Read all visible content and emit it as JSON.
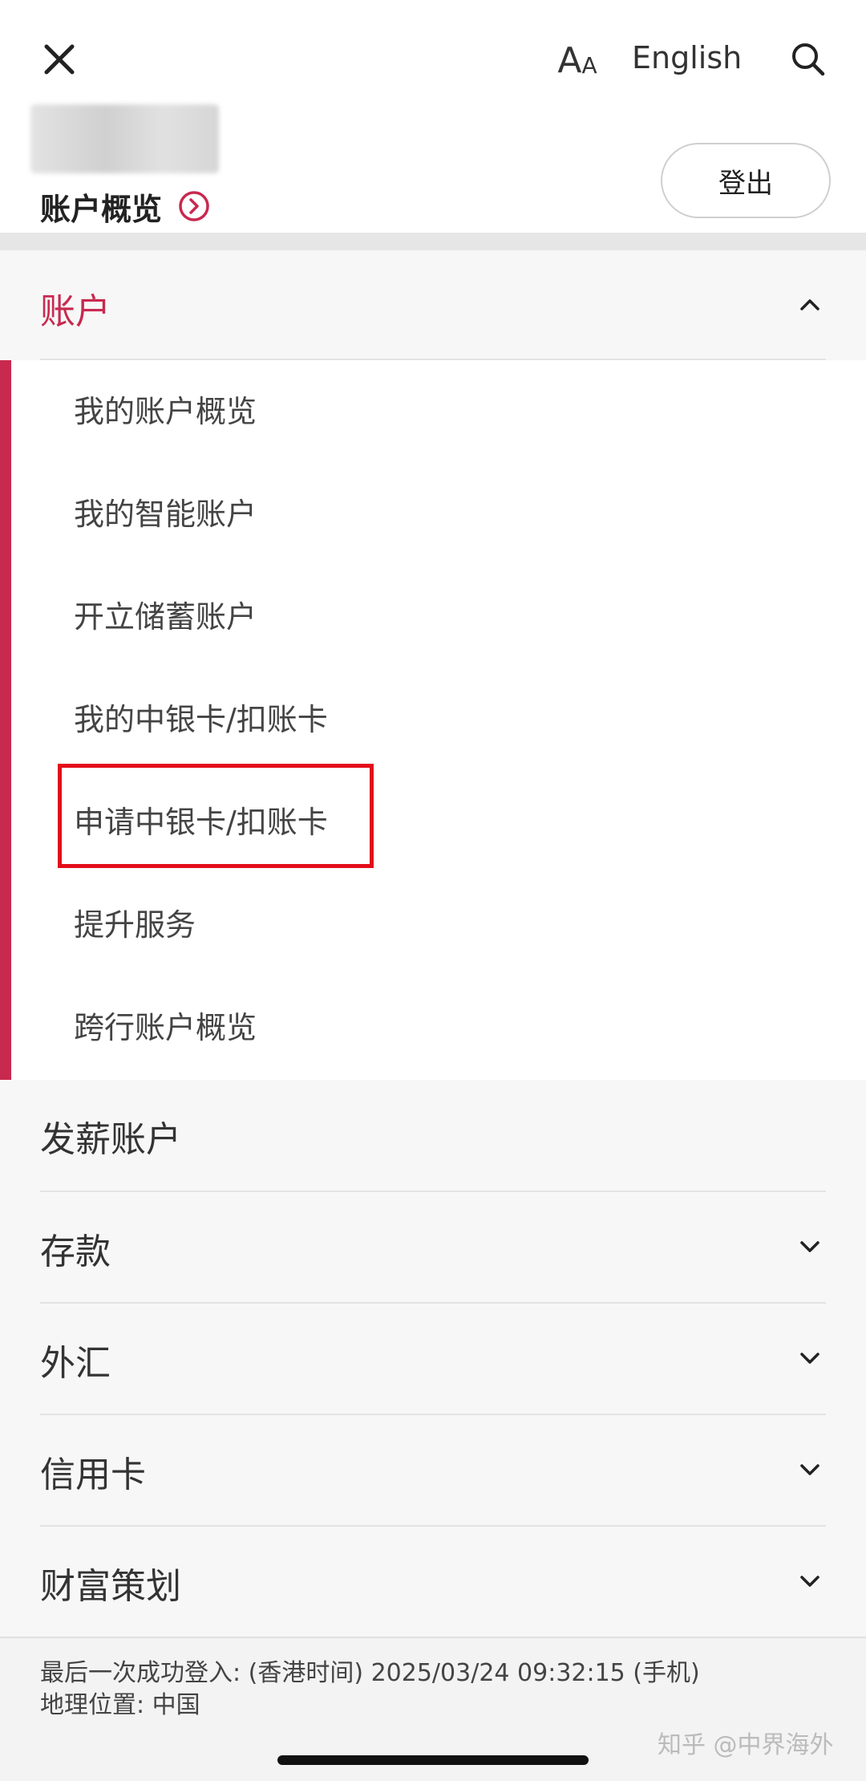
{
  "header": {
    "close_icon": "close-icon",
    "font_size_icon": "font-size-icon",
    "font_big": "A",
    "font_small": "A",
    "language_label": "English",
    "search_icon": "search-icon",
    "overview_label": "账户概览",
    "overview_icon": "chevron-right-circle-icon",
    "logout_label": "登出"
  },
  "menu": {
    "section_title": "账户",
    "section_expanded": true,
    "accent_color": "#c8294f",
    "sub_items": [
      "我的账户概览",
      "我的智能账户",
      "开立储蓄账户",
      "我的中银卡/扣账卡",
      "申请中银卡/扣账卡",
      "提升服务",
      "跨行账户概览"
    ],
    "highlighted_sub_item": "申请中银卡/扣账卡",
    "highlight_color": "#e30d1a",
    "main_items": [
      {
        "label": "发薪账户",
        "has_chevron": false
      },
      {
        "label": "存款",
        "has_chevron": true
      },
      {
        "label": "外汇",
        "has_chevron": true
      },
      {
        "label": "信用卡",
        "has_chevron": true
      },
      {
        "label": "财富策划",
        "has_chevron": true
      }
    ]
  },
  "footer": {
    "last_login": "最后一次成功登入: (香港时间) 2025/03/24 09:32:15 (手机)",
    "location": "地理位置: 中国"
  },
  "watermark": "知乎 @中界海外"
}
